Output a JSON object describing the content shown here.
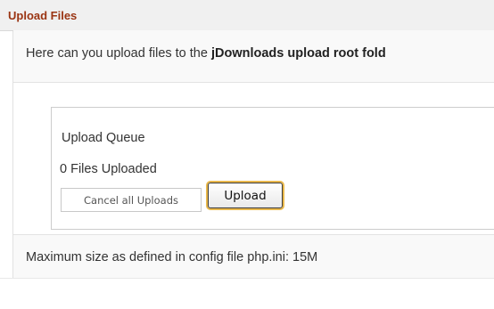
{
  "header": {
    "title": "Upload Files"
  },
  "intro": {
    "text_prefix": "Here can you upload files to the ",
    "text_bold": "jDownloads upload root fold"
  },
  "queue": {
    "title": "Upload Queue",
    "status": "0 Files Uploaded",
    "cancel_label": "Cancel all Uploads",
    "upload_label": "Upload"
  },
  "footer": {
    "text": "Maximum size as defined in config file php.ini: 15M"
  },
  "colors": {
    "header_title": "#9a3412",
    "upload_focus_ring": "#e9b84c"
  }
}
